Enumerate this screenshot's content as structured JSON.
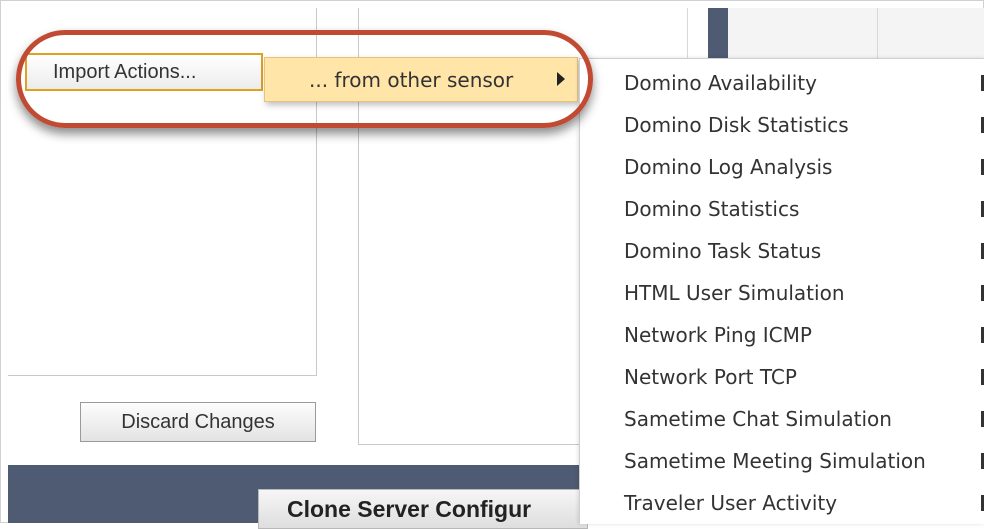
{
  "buttons": {
    "import_actions": "Import Actions...",
    "discard_changes": "Discard Changes",
    "clone_server": "Clone Server Configur"
  },
  "submenu": {
    "from_other_sensor": "... from other sensor"
  },
  "sensor_menu": {
    "items": [
      "Domino Availability",
      "Domino Disk Statistics",
      "Domino Log Analysis",
      "Domino Statistics",
      "Domino Task Status",
      "HTML User Simulation",
      "Network Ping ICMP",
      "Network Port TCP",
      "Sametime Chat Simulation",
      "Sametime Meeting Simulation",
      "Traveler User Activity"
    ]
  },
  "colors": {
    "highlight_ring": "#c14a32",
    "submenu_bg": "#ffe5a8",
    "focus_border": "#e0a020",
    "bar": "#4e5b72"
  },
  "icons": {
    "submenu_arrow": "caret-right-icon"
  }
}
